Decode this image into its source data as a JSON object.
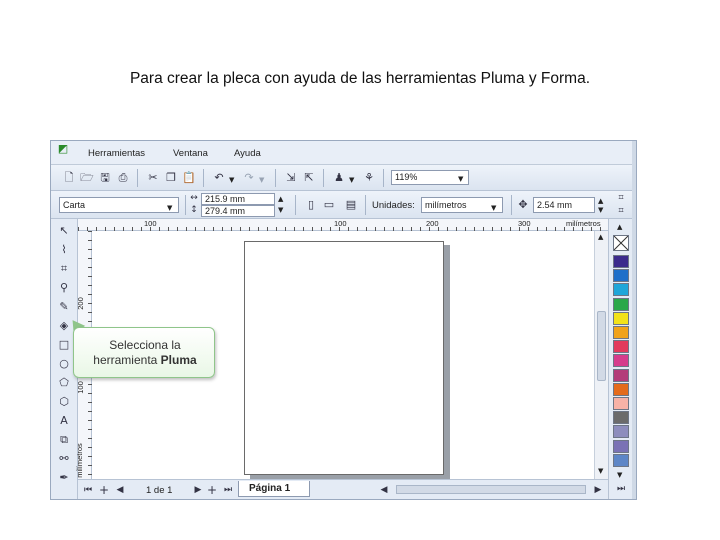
{
  "slide": {
    "title": "Para crear la pleca con ayuda de las herramientas Pluma y Forma."
  },
  "menu": {
    "items": [
      "Herramientas",
      "Ventana",
      "Ayuda"
    ]
  },
  "toolbar": {
    "zoom": "119%"
  },
  "property_bar": {
    "paper_size": "Carta",
    "width": "215.9 mm",
    "height": "279.4 mm",
    "units_label": "Unidades:",
    "units_value": "milímetros",
    "nudge": "2.54 mm"
  },
  "ruler": {
    "h_ticks": [
      "100",
      "100",
      "200",
      "300",
      "milímetros"
    ],
    "v_ticks": [
      "200",
      "100",
      "milímetros"
    ]
  },
  "callout": {
    "line1": "Selecciona la",
    "line2_prefix": "herramienta ",
    "line2_bold": "Pluma"
  },
  "status": {
    "page_count": "1 de 1",
    "page_tab": "Página 1"
  },
  "icons": {
    "toolbox": [
      "pick-tool-icon",
      "shape-tool-icon",
      "crop-tool-icon",
      "zoom-tool-icon",
      "freehand-tool-icon",
      "smart-fill-icon",
      "rectangle-tool-icon",
      "ellipse-tool-icon",
      "polygon-tool-icon",
      "basic-shapes-icon",
      "text-tool-icon",
      "interactive-blend-icon",
      "eyedropper-icon",
      "outline-pen-icon"
    ]
  },
  "palette_colors": [
    "#ffffff",
    "#3b2a8c",
    "#1f6fc9",
    "#1fa6d9",
    "#2aa84a",
    "#f2e21b",
    "#f0a21b",
    "#e23a5c",
    "#d63c8c",
    "#b33c7a",
    "#e46b1c",
    "#f7b2a7",
    "#6b6b6b",
    "#8d8dbd",
    "#7a72b5",
    "#5d86c7"
  ]
}
